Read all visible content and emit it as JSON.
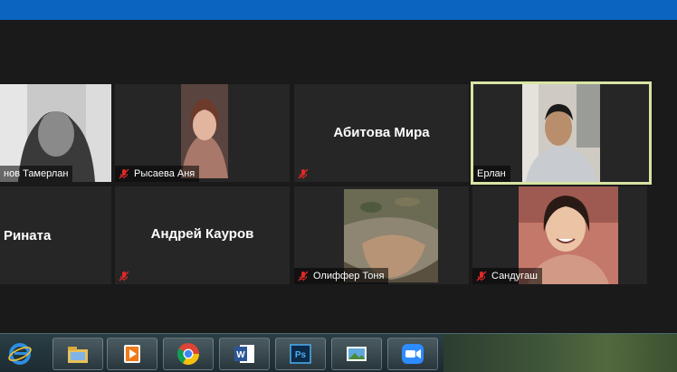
{
  "window": {
    "accent_color": "#0b64c0"
  },
  "participants": [
    {
      "id": "tamerlan",
      "name": "нов Тамерлан",
      "muted": false,
      "video": true,
      "active": false
    },
    {
      "id": "anya",
      "name": "Рысаева Аня",
      "muted": true,
      "video": true,
      "active": false
    },
    {
      "id": "mira",
      "name": "Абитова Мира",
      "muted": true,
      "video": false,
      "active": false
    },
    {
      "id": "erlan",
      "name": "Ерлан",
      "muted": false,
      "video": true,
      "active": true
    },
    {
      "id": "rinata",
      "name": "Рината",
      "muted": false,
      "video": false,
      "active": false
    },
    {
      "id": "kaurov",
      "name": "Андрей Кауров",
      "muted": true,
      "video": false,
      "active": false
    },
    {
      "id": "tonya",
      "name": "Олиффер Тоня",
      "muted": true,
      "video": true,
      "active": false
    },
    {
      "id": "sandugash",
      "name": "Сандугаш",
      "muted": true,
      "video": true,
      "active": false
    }
  ],
  "taskbar": {
    "items": [
      {
        "id": "start",
        "icon": "windows-start-icon"
      },
      {
        "id": "ie",
        "icon": "internet-explorer-icon"
      },
      {
        "id": "explorer",
        "icon": "file-explorer-icon"
      },
      {
        "id": "media",
        "icon": "media-player-icon"
      },
      {
        "id": "chrome",
        "icon": "chrome-icon"
      },
      {
        "id": "word",
        "icon": "word-icon"
      },
      {
        "id": "photoshop",
        "icon": "photoshop-icon"
      },
      {
        "id": "photos",
        "icon": "photo-viewer-icon"
      },
      {
        "id": "zoom",
        "icon": "zoom-icon"
      }
    ]
  }
}
